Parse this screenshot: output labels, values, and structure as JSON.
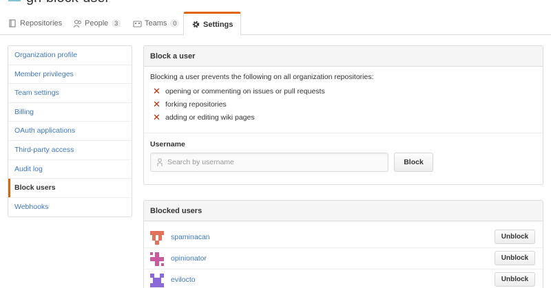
{
  "org": {
    "name": "gh-block-user"
  },
  "tabs": [
    {
      "label": "Repositories",
      "icon": "repo-icon"
    },
    {
      "label": "People",
      "count": "3",
      "icon": "people-icon"
    },
    {
      "label": "Teams",
      "count": "0",
      "icon": "teams-icon"
    },
    {
      "label": "Settings",
      "icon": "gear-icon",
      "selected": true
    }
  ],
  "menu": {
    "items": [
      "Organization profile",
      "Member privileges",
      "Team settings",
      "Billing",
      "OAuth applications",
      "Third-party access",
      "Audit log",
      "Block users",
      "Webhooks"
    ],
    "selected": "Block users"
  },
  "block": {
    "title": "Block a user",
    "intro": "Blocking a user prevents the following on all organization repositories:",
    "rules": [
      "opening or commenting on issues or pull requests",
      "forking repositories",
      "adding or editing wiki pages"
    ],
    "username_label": "Username",
    "search_placeholder": "Search by username",
    "search_value": "",
    "block_button": "Block"
  },
  "blocked": {
    "title": "Blocked users",
    "unblock_label": "Unblock",
    "users": [
      {
        "name": "spaminacan",
        "avatar_color": "#e0735a"
      },
      {
        "name": "opinionator",
        "avatar_color": "#c85aa0"
      },
      {
        "name": "evilocto",
        "avatar_color": "#8a6ad6"
      }
    ]
  },
  "colors": {
    "link": "#4078c0",
    "accent": "#e36209",
    "menu_selected_bar": "#d26911",
    "x_icon": "#bd2c00"
  }
}
